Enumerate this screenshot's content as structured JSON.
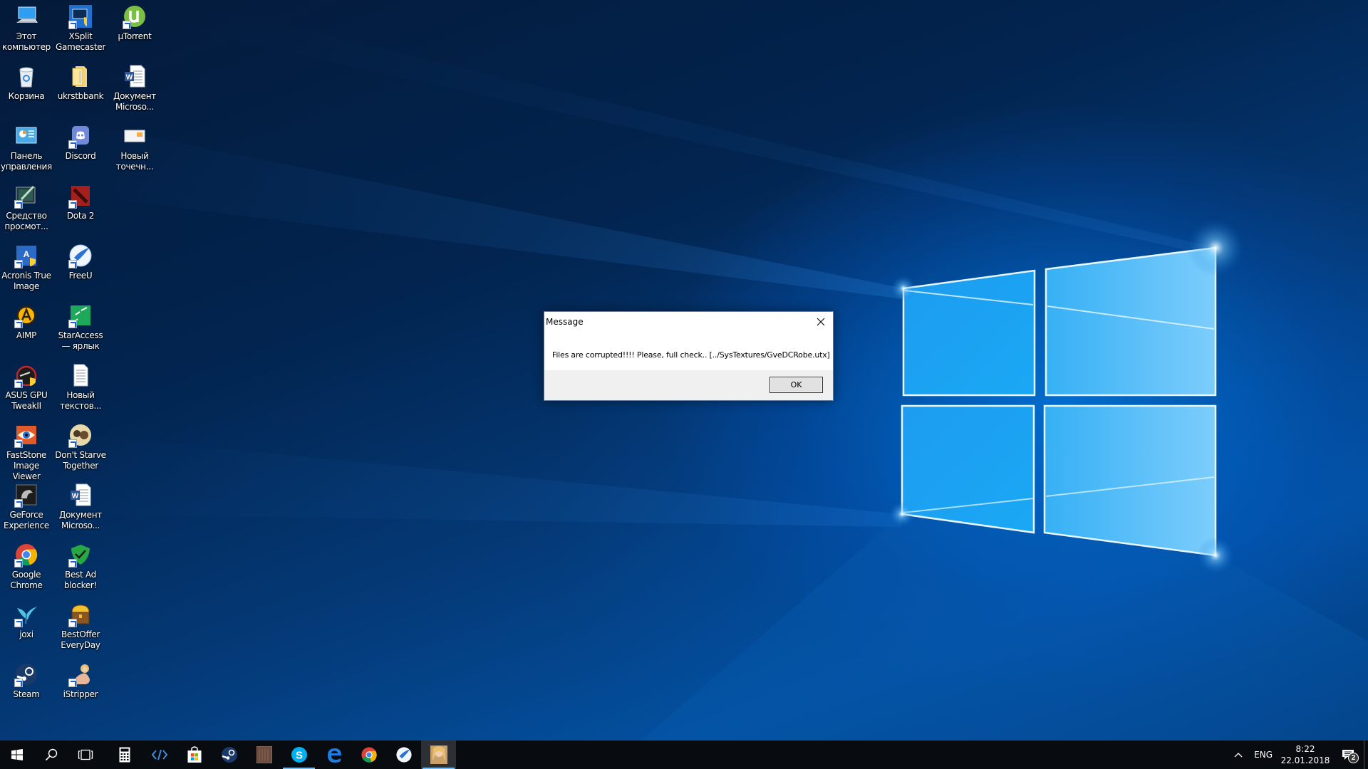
{
  "desktop": {
    "icons": [
      {
        "label": "Этот компьютер",
        "icon": "this-pc-icon",
        "shortcut": false
      },
      {
        "label": "XSplit Gamecaster",
        "icon": "xsplit-icon",
        "shortcut": true
      },
      {
        "label": "µTorrent",
        "icon": "utorrent-icon",
        "shortcut": true
      },
      {
        "label": "Корзина",
        "icon": "recycle-bin-icon",
        "shortcut": false
      },
      {
        "label": "ukrstbbank",
        "icon": "folder-icon",
        "shortcut": false
      },
      {
        "label": "Документ Microso...",
        "icon": "word-document-icon",
        "shortcut": false
      },
      {
        "label": "Панель управления",
        "icon": "control-panel-icon",
        "shortcut": false
      },
      {
        "label": "Discord",
        "icon": "discord-icon",
        "shortcut": true
      },
      {
        "label": "Новый точечн...",
        "icon": "bitmap-image-icon",
        "shortcut": false
      },
      {
        "label": "Средство просмот...",
        "icon": "viewer-tool-icon",
        "shortcut": true
      },
      {
        "label": "Dota 2",
        "icon": "dota2-icon",
        "shortcut": true
      },
      {
        "label": "Acronis True Image",
        "icon": "acronis-icon",
        "shortcut": true
      },
      {
        "label": "FreeU",
        "icon": "freeu-icon",
        "shortcut": true
      },
      {
        "label": "AIMP",
        "icon": "aimp-icon",
        "shortcut": true
      },
      {
        "label": "StarAccess — ярлык",
        "icon": "staraccess-icon",
        "shortcut": true
      },
      {
        "label": "ASUS GPU TweakII",
        "icon": "asus-gpu-tweak-icon",
        "shortcut": true
      },
      {
        "label": "Новый текстов...",
        "icon": "text-document-icon",
        "shortcut": false
      },
      {
        "label": "FastStone Image Viewer",
        "icon": "faststone-icon",
        "shortcut": true
      },
      {
        "label": "Don't Starve Together",
        "icon": "dont-starve-icon",
        "shortcut": true
      },
      {
        "label": "GeForce Experience",
        "icon": "geforce-icon",
        "shortcut": true
      },
      {
        "label": "Документ Microso...",
        "icon": "word-document-icon",
        "shortcut": false
      },
      {
        "label": "Google Chrome",
        "icon": "chrome-icon",
        "shortcut": true
      },
      {
        "label": "Best Ad blocker!",
        "icon": "adblocker-shield-icon",
        "shortcut": true
      },
      {
        "label": "joxi",
        "icon": "joxi-bird-icon",
        "shortcut": true
      },
      {
        "label": "BestOffer EveryDay",
        "icon": "treasure-chest-icon",
        "shortcut": true
      },
      {
        "label": "Steam",
        "icon": "steam-icon",
        "shortcut": true
      },
      {
        "label": "iStripper",
        "icon": "istripper-icon",
        "shortcut": true
      }
    ]
  },
  "dialog": {
    "title": "Message",
    "message": "Files are corrupted!!!! Please, full check.. [../SysTextures/GveDCRobe.utx]",
    "ok_label": "OK",
    "close_icon": "close-icon"
  },
  "taskbar": {
    "buttons": [
      {
        "name": "start-button",
        "icon": "windows-logo-icon"
      },
      {
        "name": "search-button",
        "icon": "search-icon"
      },
      {
        "name": "task-view-button",
        "icon": "task-view-icon"
      }
    ],
    "apps": [
      {
        "name": "calculator",
        "icon": "calculator-icon",
        "running": false,
        "active": false
      },
      {
        "name": "code-editor",
        "icon": "code-brackets-icon",
        "running": false,
        "active": false
      },
      {
        "name": "microsoft-store",
        "icon": "store-bag-icon",
        "running": false,
        "active": false
      },
      {
        "name": "steam",
        "icon": "steam-icon",
        "running": false,
        "active": false
      },
      {
        "name": "game-app",
        "icon": "game-tile-icon",
        "running": false,
        "active": false
      },
      {
        "name": "skype",
        "icon": "skype-icon",
        "running": true,
        "active": false
      },
      {
        "name": "edge",
        "icon": "edge-icon",
        "running": false,
        "active": false
      },
      {
        "name": "chrome",
        "icon": "chrome-icon",
        "running": false,
        "active": false
      },
      {
        "name": "freeu",
        "icon": "freeu-icon",
        "running": false,
        "active": false
      },
      {
        "name": "istripper",
        "icon": "istripper-icon",
        "running": true,
        "active": true
      }
    ],
    "tray": {
      "chevron_icon": "chevron-up-icon",
      "language": "ENG",
      "time": "8:22",
      "date": "22.01.2018",
      "notification_count": "2",
      "notification_icon": "action-center-icon"
    }
  },
  "colors": {
    "taskbar_bg": "#080b10",
    "running_indicator": "#76b9ed",
    "dialog_footer": "#f0f0f0",
    "logo_blue": "#1aa3f0"
  }
}
